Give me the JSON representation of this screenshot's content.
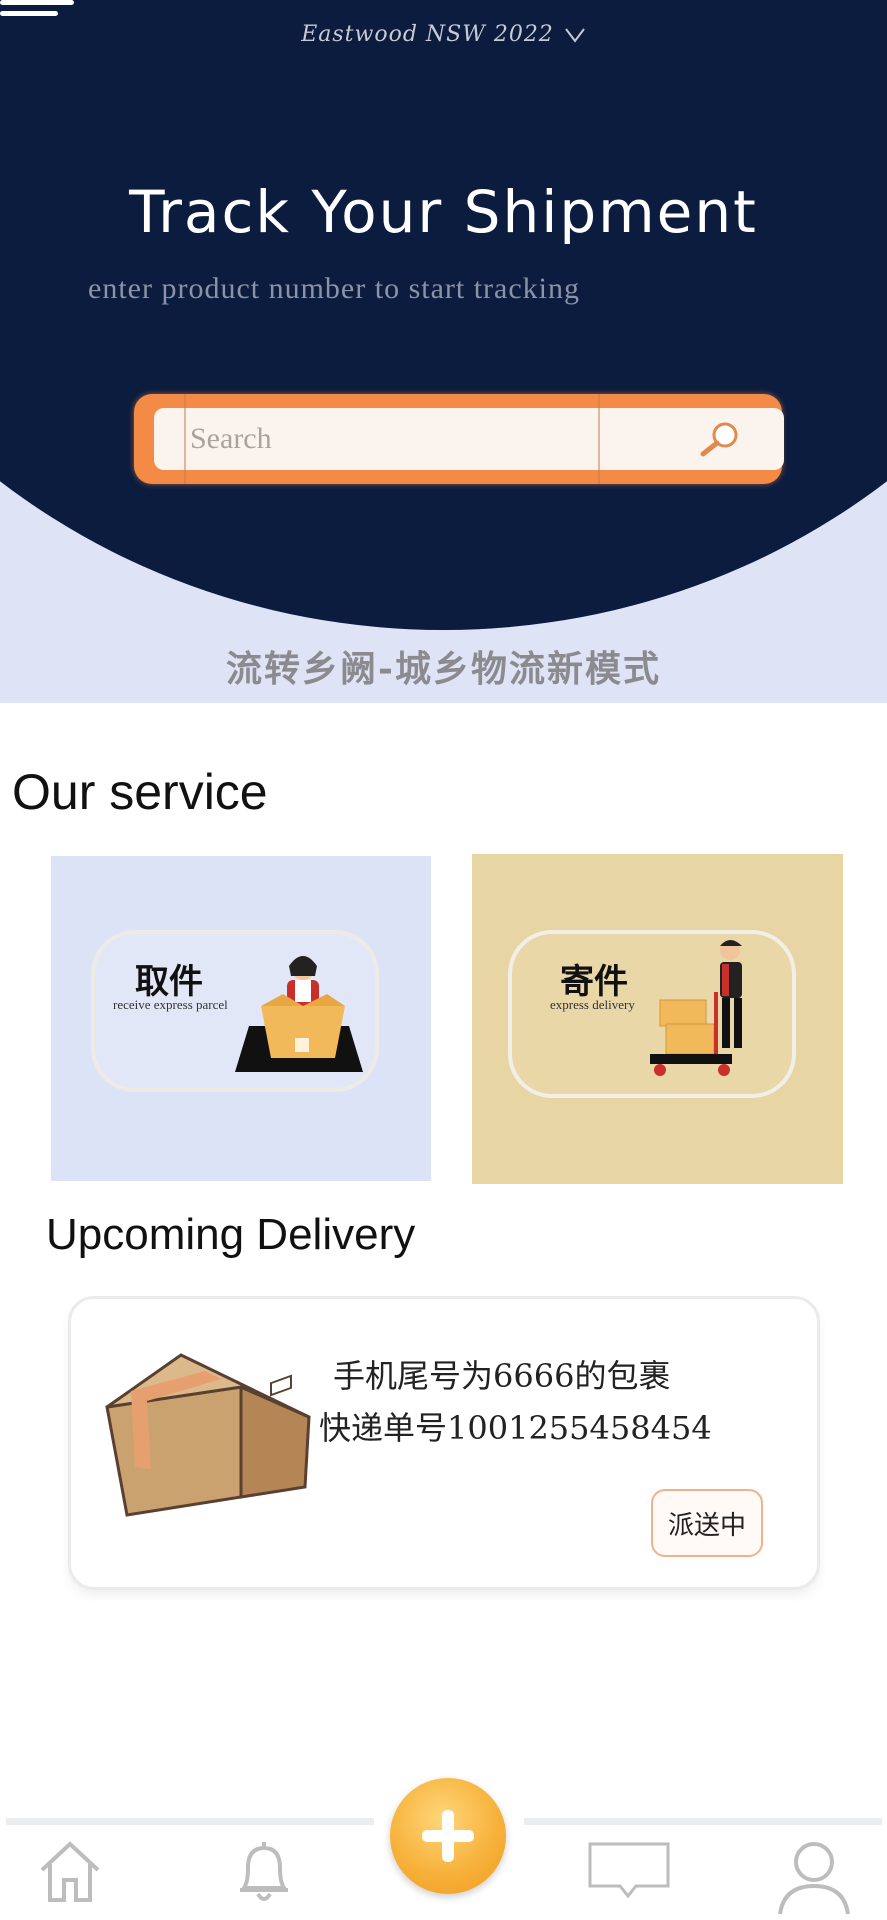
{
  "header": {
    "location": "Eastwood  NSW   2022",
    "title": "Track Your Shipment",
    "subtitle": "enter product number to start tracking",
    "slogan": "流转乡阙-城乡物流新模式"
  },
  "search": {
    "placeholder": "Search",
    "value": ""
  },
  "services": {
    "title": "Our service",
    "items": [
      {
        "title": "取件",
        "subtitle": "receive express parcel",
        "bg": "#dde3f7"
      },
      {
        "title": "寄件",
        "subtitle": "express delivery",
        "bg": "#e8d5a4"
      }
    ]
  },
  "upcoming": {
    "title": "Upcoming Delivery",
    "item": {
      "line1": "手机尾号为6666的包裹",
      "line2": "快递单号1001255458454",
      "status": "派送中"
    }
  },
  "nav": {
    "items": [
      "home-icon",
      "bell-icon",
      "add-icon",
      "message-icon",
      "user-icon"
    ]
  },
  "colors": {
    "primary_dark": "#0c1c3e",
    "accent_orange": "#f38b46",
    "fab_orange": "#f7b23c"
  }
}
